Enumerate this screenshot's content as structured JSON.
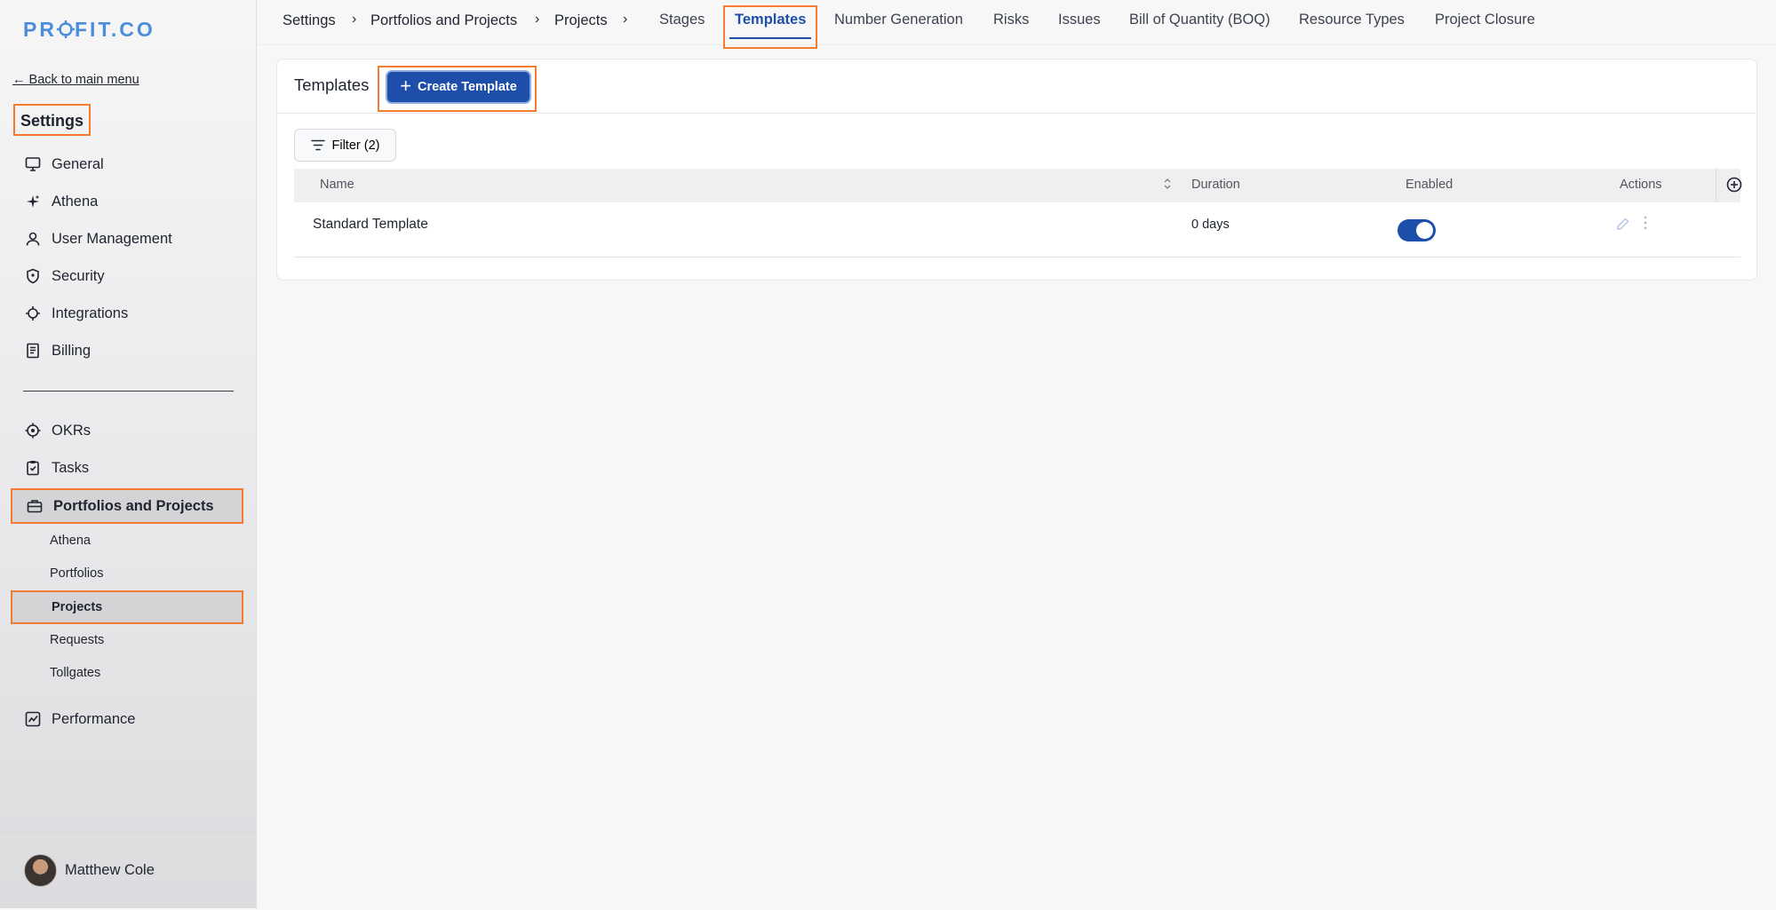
{
  "brand": {
    "logo_text": "PROFIT.CO",
    "accent": "#1d4faa",
    "highlight": "#f47b30"
  },
  "sidebar": {
    "back_link": "← Back to main menu",
    "title": "Settings",
    "items": [
      {
        "label": "General",
        "icon": "monitor-icon"
      },
      {
        "label": "Athena",
        "icon": "sparkle-icon"
      },
      {
        "label": "User Management",
        "icon": "user-icon"
      },
      {
        "label": "Security",
        "icon": "shield-icon"
      },
      {
        "label": "Integrations",
        "icon": "chip-icon"
      },
      {
        "label": "Billing",
        "icon": "receipt-icon"
      }
    ],
    "modules": [
      {
        "label": "OKRs",
        "icon": "target-icon"
      },
      {
        "label": "Tasks",
        "icon": "clipboard-check-icon"
      },
      {
        "label": "Portfolios and Projects",
        "icon": "briefcase-icon"
      }
    ],
    "sub_items": [
      "Athena",
      "Portfolios",
      "Projects",
      "Requests",
      "Tollgates"
    ],
    "performance": {
      "label": "Performance",
      "icon": "chart-icon"
    },
    "user": {
      "name": "Matthew Cole"
    }
  },
  "topbar": {
    "breadcrumbs": [
      "Settings",
      "Portfolios and Projects",
      "Projects"
    ],
    "separator": "›",
    "tabs": [
      "Stages",
      "Templates",
      "Number Generation",
      "Risks",
      "Issues",
      "Bill of Quantity (BOQ)",
      "Resource Types",
      "Project Closure"
    ],
    "active_tab": "Templates"
  },
  "main": {
    "title": "Templates",
    "create_button": "Create Template",
    "filter_button": "Filter (2)",
    "columns": [
      "Name",
      "Duration",
      "Enabled",
      "Actions"
    ],
    "rows": [
      {
        "name": "Standard Template",
        "duration": "0 days",
        "enabled": true
      }
    ]
  }
}
